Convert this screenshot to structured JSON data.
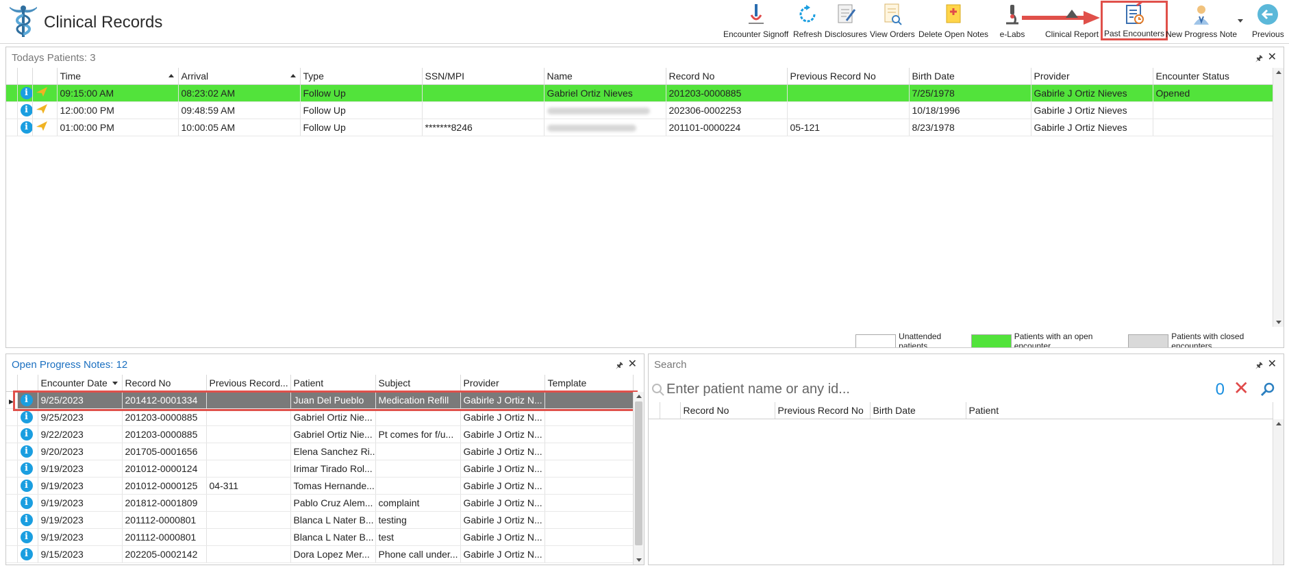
{
  "app": {
    "title": "Clinical Records"
  },
  "toolbar": {
    "items": [
      {
        "label": "Encounter Signoff",
        "icon": "pen-hand-icon"
      },
      {
        "label": "Refresh",
        "icon": "refresh-icon"
      },
      {
        "label": "Disclosures",
        "icon": "document-pen-icon"
      },
      {
        "label": "View Orders",
        "icon": "document-search-icon"
      },
      {
        "label": "Delete Open Notes",
        "icon": "note-delete-icon"
      },
      {
        "label": "e-Labs",
        "icon": "microscope-icon"
      },
      {
        "label": "Clinical Report",
        "icon": "report-icon"
      },
      {
        "label": "Past Encounters",
        "icon": "clipboard-history-icon",
        "highlighted": true
      },
      {
        "label": "New Progress Note",
        "icon": "doctor-note-icon"
      },
      {
        "label": "Previous",
        "icon": "back-arrow-icon"
      }
    ]
  },
  "todays_patients": {
    "title": "Todays Patients:",
    "count": "3",
    "columns": [
      "Time",
      "Arrival",
      "Type",
      "SSN/MPI",
      "Name",
      "Record No",
      "Previous Record No",
      "Birth Date",
      "Provider",
      "Encounter Status"
    ],
    "rows": [
      {
        "time": "09:15:00 AM",
        "arrival": "08:23:02 AM",
        "type": "Follow Up",
        "ssn": "",
        "name": "Gabriel Ortiz Nieves",
        "record_no": "201203-0000885",
        "prev_record": "",
        "birth_date": "7/25/1978",
        "provider": "Gabirle J Ortiz Nieves",
        "status": "Opened"
      },
      {
        "time": "12:00:00 PM",
        "arrival": "09:48:59 AM",
        "type": "Follow Up",
        "ssn": "",
        "name": "",
        "record_no": "202306-0002253",
        "prev_record": "",
        "birth_date": "10/18/1996",
        "provider": "Gabirle J Ortiz Nieves",
        "status": ""
      },
      {
        "time": "01:00:00 PM",
        "arrival": "10:00:05 AM",
        "type": "Follow Up",
        "ssn": "*******8246",
        "name": "",
        "record_no": "201101-0000224",
        "prev_record": "05-121",
        "birth_date": "8/23/1978",
        "provider": "Gabirle J Ortiz Nieves",
        "status": ""
      }
    ],
    "legend": {
      "unattended": "Unattended patients",
      "open": "Patients with an open encounter",
      "closed": "Patients with closed encounters"
    }
  },
  "open_notes": {
    "title": "Open Progress Notes:",
    "count": "12",
    "columns": [
      "Encounter Date",
      "Record No",
      "Previous Record...",
      "Patient",
      "Subject",
      "Provider",
      "Template"
    ],
    "rows": [
      {
        "date": "9/25/2023",
        "record_no": "201412-0001334",
        "prev": "",
        "patient": "Juan Del Pueblo",
        "subject": "Medication Refill",
        "provider": "Gabirle J Ortiz N...",
        "template": ""
      },
      {
        "date": "9/25/2023",
        "record_no": "201203-0000885",
        "prev": "",
        "patient": "Gabriel Ortiz Nie...",
        "subject": "",
        "provider": "Gabirle J Ortiz N...",
        "template": ""
      },
      {
        "date": "9/22/2023",
        "record_no": "201203-0000885",
        "prev": "",
        "patient": "Gabriel Ortiz Nie...",
        "subject": "Pt comes for f/u...",
        "provider": "Gabirle J Ortiz N...",
        "template": ""
      },
      {
        "date": "9/20/2023",
        "record_no": "201705-0001656",
        "prev": "",
        "patient": "Elena Sanchez Ri...",
        "subject": "",
        "provider": "Gabirle J Ortiz N...",
        "template": ""
      },
      {
        "date": "9/19/2023",
        "record_no": "201012-0000124",
        "prev": "",
        "patient": "Irimar Tirado Rol...",
        "subject": "",
        "provider": "Gabirle J Ortiz N...",
        "template": ""
      },
      {
        "date": "9/19/2023",
        "record_no": "201012-0000125",
        "prev": "04-311",
        "patient": "Tomas Hernande...",
        "subject": "",
        "provider": "Gabirle J Ortiz N...",
        "template": ""
      },
      {
        "date": "9/19/2023",
        "record_no": "201812-0001809",
        "prev": "",
        "patient": "Pablo Cruz Alem...",
        "subject": "complaint",
        "provider": "Gabirle J Ortiz N...",
        "template": ""
      },
      {
        "date": "9/19/2023",
        "record_no": "201112-0000801",
        "prev": "",
        "patient": "Blanca L Nater B...",
        "subject": "testing",
        "provider": "Gabirle J Ortiz N...",
        "template": ""
      },
      {
        "date": "9/19/2023",
        "record_no": "201112-0000801",
        "prev": "",
        "patient": "Blanca L Nater B...",
        "subject": "test",
        "provider": "Gabirle J Ortiz N...",
        "template": ""
      },
      {
        "date": "9/15/2023",
        "record_no": "202205-0002142",
        "prev": "",
        "patient": "Dora Lopez Mer...",
        "subject": "Phone call under...",
        "provider": "Gabirle J Ortiz N...",
        "template": ""
      }
    ]
  },
  "search": {
    "title": "Search",
    "placeholder": "Enter patient name or any id...",
    "count": "0",
    "columns": [
      "Record No",
      "Previous Record No",
      "Birth Date",
      "Patient"
    ]
  },
  "colors": {
    "open_encounter": "#52e33b",
    "closed_encounter": "#d9d9d9",
    "selected_row": "#7a7a7a",
    "highlight": "#e0504a",
    "accent": "#1a8fe0"
  }
}
